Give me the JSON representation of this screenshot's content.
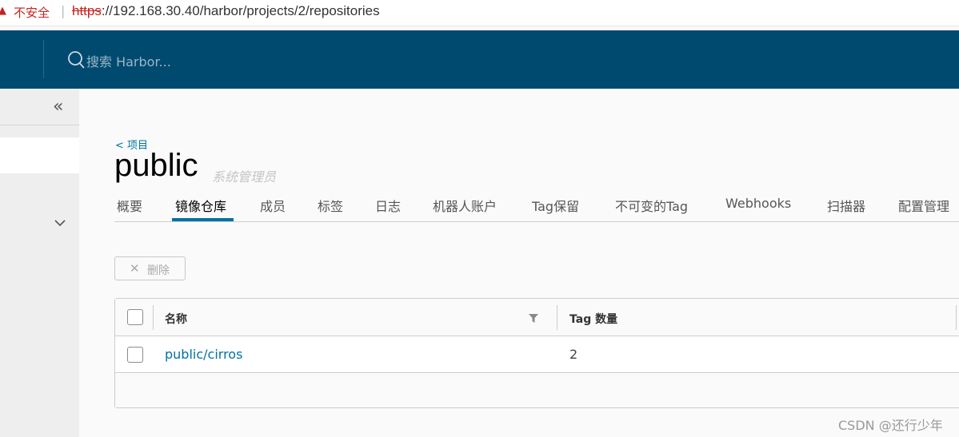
{
  "browser": {
    "insecure_label": "不安全",
    "url_scheme": "https",
    "url_rest": "://192.168.30.40/harbor/projects/2/repositories"
  },
  "header": {
    "search_placeholder": "搜索 Harbor..."
  },
  "page": {
    "back_link": "< 项目",
    "title": "public",
    "role": "系统管理员"
  },
  "tabs": [
    "概要",
    "镜像仓库",
    "成员",
    "标签",
    "日志",
    "机器人账户",
    "Tag保留",
    "不可变的Tag",
    "Webhooks",
    "扫描器",
    "配置管理"
  ],
  "active_tab": "镜像仓库",
  "toolbar": {
    "delete_label": "删除"
  },
  "table": {
    "columns": [
      "名称",
      "Tag 数量"
    ],
    "rows": [
      {
        "name": "public/cirros",
        "tag_count": "2"
      }
    ]
  },
  "watermark": "CSDN @还行少年",
  "colors": {
    "header_bg": "#004a70",
    "accent": "#0072a3",
    "warning": "#c5221f"
  }
}
